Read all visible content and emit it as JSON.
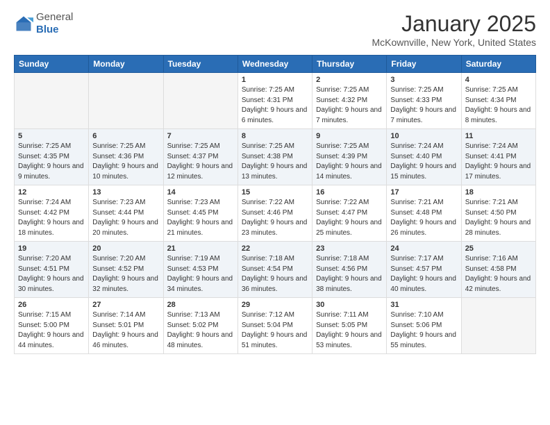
{
  "logo": {
    "general": "General",
    "blue": "Blue"
  },
  "title": "January 2025",
  "location": "McKownville, New York, United States",
  "days_of_week": [
    "Sunday",
    "Monday",
    "Tuesday",
    "Wednesday",
    "Thursday",
    "Friday",
    "Saturday"
  ],
  "weeks": [
    {
      "alt": false,
      "days": [
        {
          "num": "",
          "info": ""
        },
        {
          "num": "",
          "info": ""
        },
        {
          "num": "",
          "info": ""
        },
        {
          "num": "1",
          "info": "Sunrise: 7:25 AM\nSunset: 4:31 PM\nDaylight: 9 hours and 6 minutes."
        },
        {
          "num": "2",
          "info": "Sunrise: 7:25 AM\nSunset: 4:32 PM\nDaylight: 9 hours and 7 minutes."
        },
        {
          "num": "3",
          "info": "Sunrise: 7:25 AM\nSunset: 4:33 PM\nDaylight: 9 hours and 7 minutes."
        },
        {
          "num": "4",
          "info": "Sunrise: 7:25 AM\nSunset: 4:34 PM\nDaylight: 9 hours and 8 minutes."
        }
      ]
    },
    {
      "alt": true,
      "days": [
        {
          "num": "5",
          "info": "Sunrise: 7:25 AM\nSunset: 4:35 PM\nDaylight: 9 hours and 9 minutes."
        },
        {
          "num": "6",
          "info": "Sunrise: 7:25 AM\nSunset: 4:36 PM\nDaylight: 9 hours and 10 minutes."
        },
        {
          "num": "7",
          "info": "Sunrise: 7:25 AM\nSunset: 4:37 PM\nDaylight: 9 hours and 12 minutes."
        },
        {
          "num": "8",
          "info": "Sunrise: 7:25 AM\nSunset: 4:38 PM\nDaylight: 9 hours and 13 minutes."
        },
        {
          "num": "9",
          "info": "Sunrise: 7:25 AM\nSunset: 4:39 PM\nDaylight: 9 hours and 14 minutes."
        },
        {
          "num": "10",
          "info": "Sunrise: 7:24 AM\nSunset: 4:40 PM\nDaylight: 9 hours and 15 minutes."
        },
        {
          "num": "11",
          "info": "Sunrise: 7:24 AM\nSunset: 4:41 PM\nDaylight: 9 hours and 17 minutes."
        }
      ]
    },
    {
      "alt": false,
      "days": [
        {
          "num": "12",
          "info": "Sunrise: 7:24 AM\nSunset: 4:42 PM\nDaylight: 9 hours and 18 minutes."
        },
        {
          "num": "13",
          "info": "Sunrise: 7:23 AM\nSunset: 4:44 PM\nDaylight: 9 hours and 20 minutes."
        },
        {
          "num": "14",
          "info": "Sunrise: 7:23 AM\nSunset: 4:45 PM\nDaylight: 9 hours and 21 minutes."
        },
        {
          "num": "15",
          "info": "Sunrise: 7:22 AM\nSunset: 4:46 PM\nDaylight: 9 hours and 23 minutes."
        },
        {
          "num": "16",
          "info": "Sunrise: 7:22 AM\nSunset: 4:47 PM\nDaylight: 9 hours and 25 minutes."
        },
        {
          "num": "17",
          "info": "Sunrise: 7:21 AM\nSunset: 4:48 PM\nDaylight: 9 hours and 26 minutes."
        },
        {
          "num": "18",
          "info": "Sunrise: 7:21 AM\nSunset: 4:50 PM\nDaylight: 9 hours and 28 minutes."
        }
      ]
    },
    {
      "alt": true,
      "days": [
        {
          "num": "19",
          "info": "Sunrise: 7:20 AM\nSunset: 4:51 PM\nDaylight: 9 hours and 30 minutes."
        },
        {
          "num": "20",
          "info": "Sunrise: 7:20 AM\nSunset: 4:52 PM\nDaylight: 9 hours and 32 minutes."
        },
        {
          "num": "21",
          "info": "Sunrise: 7:19 AM\nSunset: 4:53 PM\nDaylight: 9 hours and 34 minutes."
        },
        {
          "num": "22",
          "info": "Sunrise: 7:18 AM\nSunset: 4:54 PM\nDaylight: 9 hours and 36 minutes."
        },
        {
          "num": "23",
          "info": "Sunrise: 7:18 AM\nSunset: 4:56 PM\nDaylight: 9 hours and 38 minutes."
        },
        {
          "num": "24",
          "info": "Sunrise: 7:17 AM\nSunset: 4:57 PM\nDaylight: 9 hours and 40 minutes."
        },
        {
          "num": "25",
          "info": "Sunrise: 7:16 AM\nSunset: 4:58 PM\nDaylight: 9 hours and 42 minutes."
        }
      ]
    },
    {
      "alt": false,
      "days": [
        {
          "num": "26",
          "info": "Sunrise: 7:15 AM\nSunset: 5:00 PM\nDaylight: 9 hours and 44 minutes."
        },
        {
          "num": "27",
          "info": "Sunrise: 7:14 AM\nSunset: 5:01 PM\nDaylight: 9 hours and 46 minutes."
        },
        {
          "num": "28",
          "info": "Sunrise: 7:13 AM\nSunset: 5:02 PM\nDaylight: 9 hours and 48 minutes."
        },
        {
          "num": "29",
          "info": "Sunrise: 7:12 AM\nSunset: 5:04 PM\nDaylight: 9 hours and 51 minutes."
        },
        {
          "num": "30",
          "info": "Sunrise: 7:11 AM\nSunset: 5:05 PM\nDaylight: 9 hours and 53 minutes."
        },
        {
          "num": "31",
          "info": "Sunrise: 7:10 AM\nSunset: 5:06 PM\nDaylight: 9 hours and 55 minutes."
        },
        {
          "num": "",
          "info": ""
        }
      ]
    }
  ]
}
